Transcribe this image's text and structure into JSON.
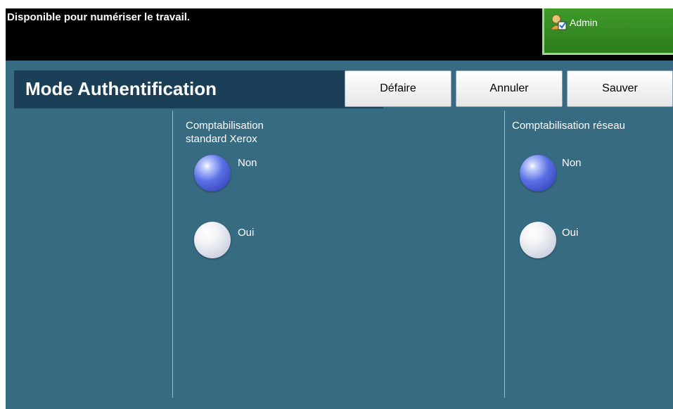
{
  "status_bar": {
    "message": "Disponible pour numériser le travail.",
    "admin_label": "Admin",
    "admin_icon": "user-admin-icon"
  },
  "header": {
    "title": "Mode Authentification",
    "buttons": {
      "undo": "Défaire",
      "cancel": "Annuler",
      "save": "Sauver"
    }
  },
  "sections": {
    "xerox_accounting": {
      "label": "Comptabilisation standard Xerox",
      "options": [
        "Non",
        "Oui"
      ],
      "selected": "Non"
    },
    "network_accounting": {
      "label": "Comptabilisation réseau",
      "options": [
        "Non",
        "Oui"
      ],
      "selected": "Non"
    }
  },
  "colors": {
    "panel": "#376b82",
    "title_bar": "#1b3f57",
    "admin_green": "#2c7d1c",
    "radio_selected": "#3a4fd0"
  }
}
